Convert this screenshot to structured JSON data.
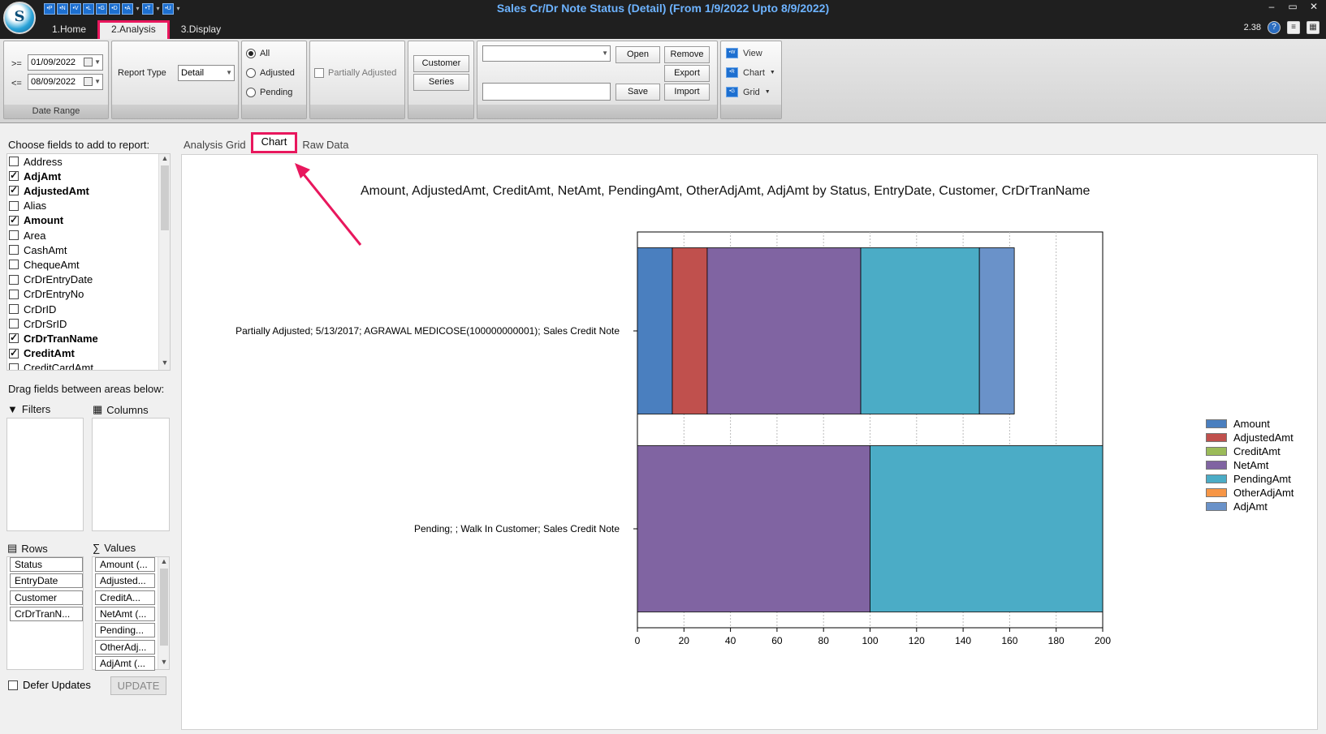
{
  "window": {
    "title": "Sales Cr/Dr Note Status (Detail)  (From 1/9/2022 Upto 8/9/2022)",
    "logo_letter": "S",
    "clock": "2.38",
    "controls": [
      "–",
      "▭",
      "✕"
    ]
  },
  "quick_toolbar": [
    "•P",
    "•N",
    "•V",
    "•L",
    "•G",
    "•D",
    "•A",
    "•T",
    "•U"
  ],
  "menu_tabs": [
    {
      "label": "1.Home",
      "active": false
    },
    {
      "label": "2.Analysis",
      "active": true
    },
    {
      "label": "3.Display",
      "active": false
    }
  ],
  "ribbon": {
    "date_range": {
      "label": "Date Range",
      "from_op": ">=",
      "from_value": "01/09/2022",
      "to_op": "<=",
      "to_value": "08/09/2022"
    },
    "report_type": {
      "label": "Report Type",
      "value": "Detail"
    },
    "status_filter": {
      "options": [
        "All",
        "Adjusted",
        "Pending"
      ],
      "selected": "All"
    },
    "partially_adjusted": {
      "label": "Partially Adjusted",
      "checked": false
    },
    "customer_label": "Customer",
    "series_label": "Series",
    "layout": {
      "layout_value": "",
      "name_value": "",
      "open_label": "Open",
      "remove_label": "Remove",
      "export_label": "Export",
      "save_label": "Save",
      "import_label": "Import"
    },
    "view_menu": {
      "view_label": "View",
      "chart_label": "Chart",
      "grid_label": "Grid"
    }
  },
  "left_panel": {
    "choose_caption": "Choose fields to add to report:",
    "fields": [
      {
        "name": "Address",
        "checked": false
      },
      {
        "name": "AdjAmt",
        "checked": true
      },
      {
        "name": "AdjustedAmt",
        "checked": true
      },
      {
        "name": "Alias",
        "checked": false
      },
      {
        "name": "Amount",
        "checked": true
      },
      {
        "name": "Area",
        "checked": false
      },
      {
        "name": "CashAmt",
        "checked": false
      },
      {
        "name": "ChequeAmt",
        "checked": false
      },
      {
        "name": "CrDrEntryDate",
        "checked": false
      },
      {
        "name": "CrDrEntryNo",
        "checked": false
      },
      {
        "name": "CrDrID",
        "checked": false
      },
      {
        "name": "CrDrSrID",
        "checked": false
      },
      {
        "name": "CrDrTranName",
        "checked": true
      },
      {
        "name": "CreditAmt",
        "checked": true
      },
      {
        "name": "CreditCardAmt",
        "checked": false
      }
    ],
    "drag_caption": "Drag fields between areas below:",
    "filters_label": "Filters",
    "columns_label": "Columns",
    "rows_label": "Rows",
    "values_label": "Values",
    "rows": [
      "Status",
      "EntryDate",
      "Customer",
      "CrDrTranN..."
    ],
    "values": [
      "Amount (...",
      "Adjusted...",
      "CreditA...",
      "NetAmt (...",
      "Pending...",
      "OtherAdj...",
      "AdjAmt (..."
    ],
    "defer_label": "Defer Updates",
    "update_label": "UPDATE"
  },
  "main_tabs": [
    {
      "label": "Analysis Grid",
      "active": false
    },
    {
      "label": "Chart",
      "active": true
    },
    {
      "label": "Raw Data",
      "active": false
    }
  ],
  "chart_data": {
    "type": "bar",
    "orientation": "horizontal",
    "stacked": true,
    "title": "Amount, AdjustedAmt, CreditAmt, NetAmt, PendingAmt, OtherAdjAmt, AdjAmt by Status, EntryDate, Customer, CrDrTranName",
    "categories": [
      "Partially Adjusted; 5/13/2017; AGRAWAL MEDICOSE(100000000001); Sales Credit Note",
      "Pending; ; Walk In Customer; Sales Credit Note"
    ],
    "series": [
      {
        "name": "Amount",
        "color": "#4a7fbf",
        "values": [
          15,
          0
        ]
      },
      {
        "name": "AdjustedAmt",
        "color": "#c0504d",
        "values": [
          15,
          0
        ]
      },
      {
        "name": "CreditAmt",
        "color": "#9bbb59",
        "values": [
          0,
          0
        ]
      },
      {
        "name": "NetAmt",
        "color": "#8064a2",
        "values": [
          66,
          100
        ]
      },
      {
        "name": "PendingAmt",
        "color": "#4bacc6",
        "values": [
          51,
          100
        ]
      },
      {
        "name": "OtherAdjAmt",
        "color": "#f79646",
        "values": [
          0,
          0
        ]
      },
      {
        "name": "AdjAmt",
        "color": "#6a92c9",
        "values": [
          15,
          0
        ]
      }
    ],
    "xlim": [
      0,
      200
    ],
    "xticks": [
      0,
      20,
      40,
      60,
      80,
      100,
      120,
      140,
      160,
      180,
      200
    ],
    "grid": true,
    "legend": "right"
  }
}
